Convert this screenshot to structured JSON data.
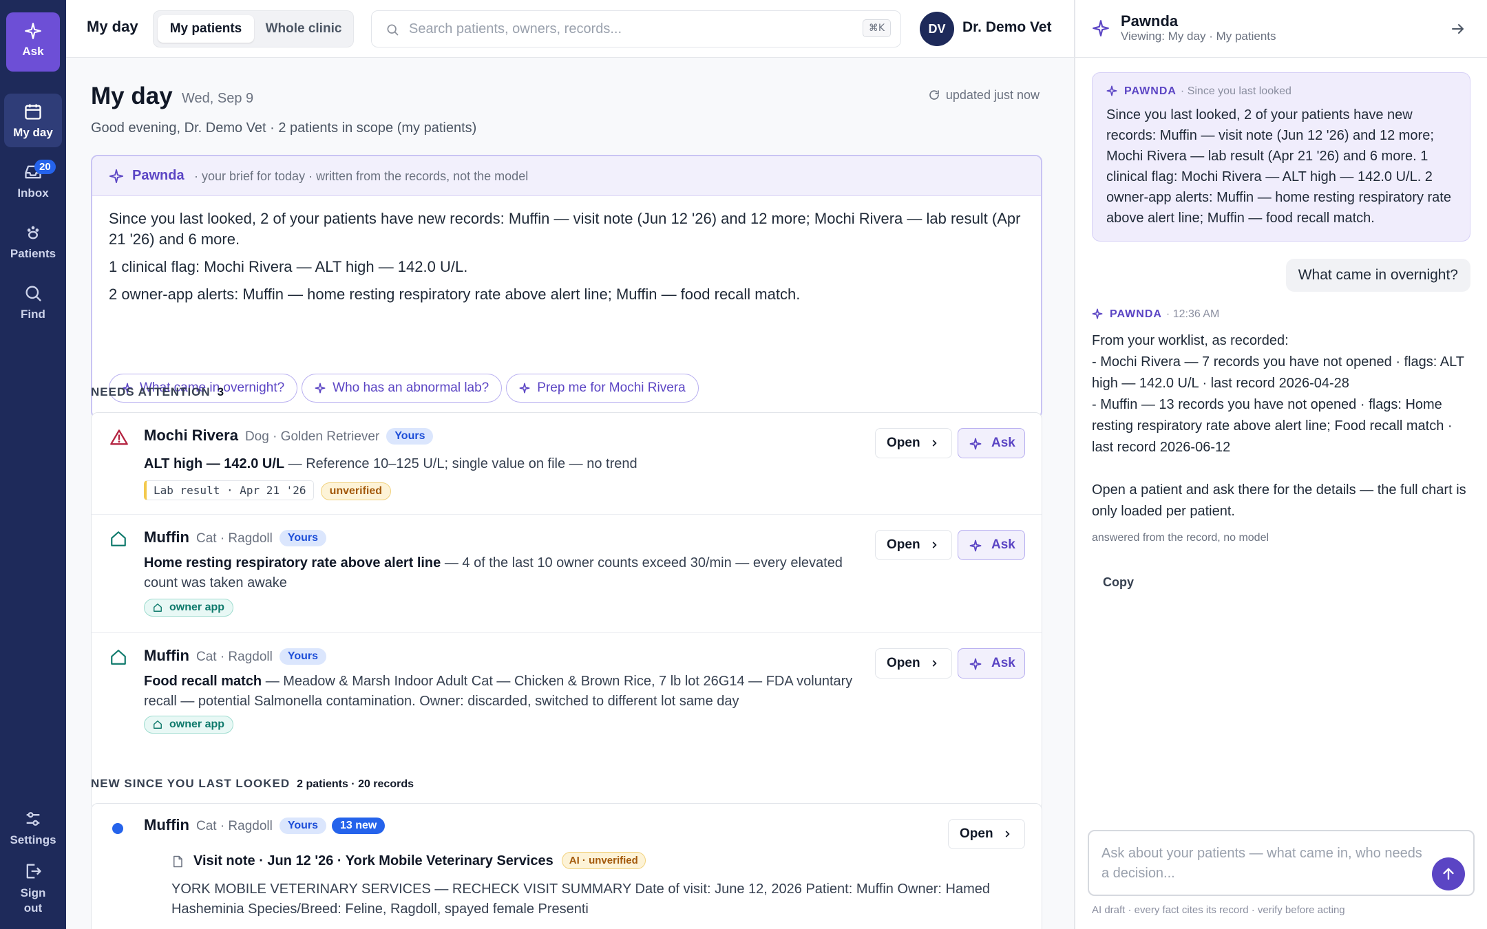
{
  "rail": {
    "ask_label": "Ask",
    "items": [
      {
        "label": "My day",
        "icon": "calendar-icon",
        "active": true
      },
      {
        "label": "Inbox",
        "icon": "inbox-icon",
        "badge": "20"
      },
      {
        "label": "Patients",
        "icon": "paw-icon"
      },
      {
        "label": "Find",
        "icon": "search-icon"
      }
    ],
    "settings_label": "Settings",
    "signout_label": "Sign out"
  },
  "topbar": {
    "title": "My day",
    "scope_options": [
      "My patients",
      "Whole clinic"
    ],
    "scope_selected": "My patients",
    "search_placeholder": "Search patients, owners, records...",
    "search_shortcut": "⌘K",
    "avatar_initials": "DV",
    "user_name": "Dr. Demo Vet"
  },
  "page": {
    "heading": "My day",
    "date": "Wed, Sep 9",
    "updated": "updated just now",
    "greeting": "Good evening, Dr. Demo Vet · 2 patients in scope (my patients)"
  },
  "brief": {
    "name": "Pawnda",
    "subtitle": "· your brief for today · written from the records, not the model",
    "lines": [
      "Since you last looked, 2 of your patients have new records: Muffin — visit note (Jun 12 '26) and 12 more; Mochi Rivera — lab result (Apr 21 '26) and 6 more.",
      "1 clinical flag: Mochi Rivera — ALT high — 142.0 U/L.",
      "2 owner-app alerts: Muffin — home resting respiratory rate above alert line; Muffin — food recall match."
    ],
    "chips": [
      "What came in overnight?",
      "Who has an abnormal lab?",
      "Prep me for Mochi Rivera"
    ]
  },
  "needs_attention": {
    "label": "NEEDS ATTENTION",
    "count": "3",
    "items": [
      {
        "patient": "Mochi Rivera",
        "species": "Dog · Golden Retriever",
        "tag": "Yours",
        "title": "ALT high — 142.0 U/L",
        "detail": " — Reference 10–125 U/L; single value on file — no trend",
        "source": "Lab result · Apr 21 '26",
        "status": "unverified",
        "icon": "warning-icon"
      },
      {
        "patient": "Muffin",
        "species": "Cat · Ragdoll",
        "tag": "Yours",
        "title": "Home resting respiratory rate above alert line",
        "detail": " — 4 of the last 10 owner counts exceed 30/min — every elevated count was taken awake",
        "source": "owner app",
        "icon": "home-icon"
      },
      {
        "patient": "Muffin",
        "species": "Cat · Ragdoll",
        "tag": "Yours",
        "title": "Food recall match",
        "detail": " — Meadow & Marsh Indoor Adult Cat — Chicken & Brown Rice, 7 lb lot 26G14 — FDA voluntary recall — potential Salmonella contamination. Owner: discarded, switched to different lot same day",
        "source": "owner app",
        "icon": "home-icon"
      }
    ],
    "open_label": "Open",
    "ask_label": "Ask"
  },
  "new_since": {
    "label": "NEW SINCE YOU LAST LOOKED",
    "summary": "2 patients · 20 records",
    "patient": "Muffin",
    "species": "Cat · Ragdoll",
    "tag": "Yours",
    "new_count": "13 new",
    "open_label": "Open",
    "record_title": "Visit note · Jun 12 '26 · York Mobile Veterinary Services",
    "record_status": "AI · unverified",
    "record_excerpt": "YORK MOBILE VETERINARY SERVICES — RECHECK VISIT SUMMARY Date of visit: June 12, 2026 Patient: Muffin Owner: Hamed Hasheminia Species/Breed: Feline, Ragdoll, spayed female Presenti"
  },
  "chat": {
    "name": "Pawnda",
    "context": "Viewing: My day · My patients",
    "first": {
      "sender": "PAWNDA",
      "time": "· Since you last looked",
      "text": "Since you last looked, 2 of your patients have new records: Muffin — visit note (Jun 12 '26) and 12 more; Mochi Rivera — lab result (Apr 21 '26) and 6 more. 1 clinical flag: Mochi Rivera — ALT high — 142.0 U/L. 2 owner-app alerts: Muffin — home resting respiratory rate above alert line; Muffin — food recall match."
    },
    "user_message": "What came in overnight?",
    "reply": {
      "sender": "PAWNDA",
      "time": "· 12:36 AM",
      "text": "From your worklist, as recorded:\n- Mochi Rivera — 7 records you have not opened · flags: ALT high — 142.0 U/L · last record 2026-04-28\n- Muffin — 13 records you have not opened · flags: Home resting respiratory rate above alert line; Food recall match · last record 2026-06-12\n\nOpen a patient and ask there for the details — the full chart is only loaded per patient.",
      "note": "answered from the record, no model"
    },
    "copy_label": "Copy",
    "composer_placeholder": "Ask about your patients — what came in, who needs a decision...",
    "disclaimer": "AI draft · every fact cites its record · verify before acting"
  }
}
